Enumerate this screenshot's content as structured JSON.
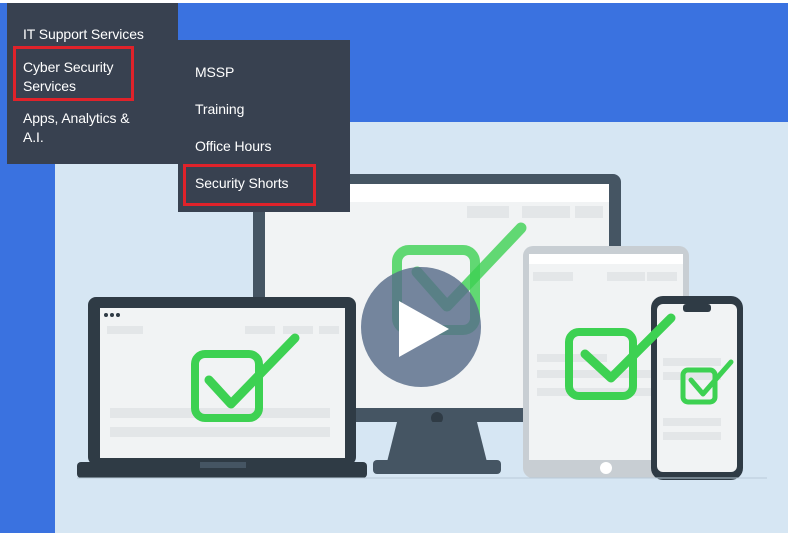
{
  "menu": {
    "primary": [
      {
        "label": "IT Support Services"
      },
      {
        "label": "Cyber Security Services"
      },
      {
        "label": "Apps, Analytics & A.I."
      }
    ],
    "submenu": [
      {
        "label": "MSSP"
      },
      {
        "label": "Training"
      },
      {
        "label": "Office Hours"
      },
      {
        "label": "Security Shorts"
      }
    ],
    "highlight_color": "#e0222a",
    "background_color": "#384150"
  },
  "banner": {
    "color": "#3a72e0"
  },
  "video": {
    "background_color": "#d6e6f3",
    "check_color": "#3dd152",
    "play_icon": "play-icon"
  }
}
